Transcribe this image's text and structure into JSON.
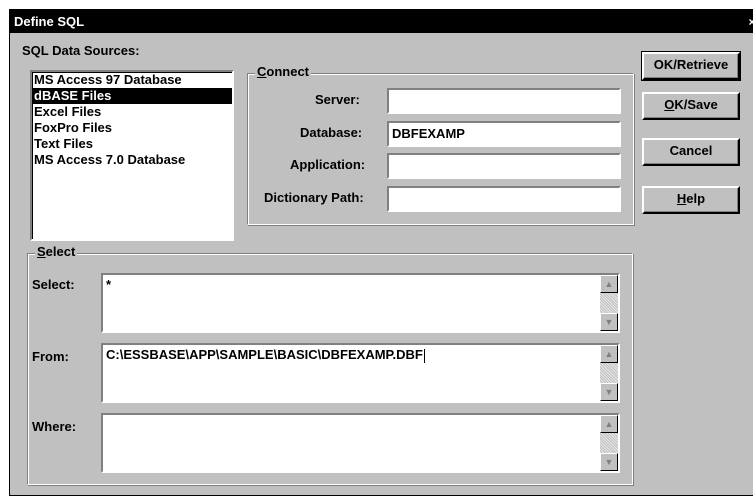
{
  "window": {
    "title": "Define SQL",
    "close_glyph": "×"
  },
  "data_sources": {
    "label": "SQL Data Sources:",
    "items": [
      "MS Access 97 Database",
      "dBASE Files",
      "Excel Files",
      "FoxPro Files",
      "Text Files",
      "MS Access 7.0 Database"
    ],
    "selected": "dBASE Files"
  },
  "connect": {
    "title_accel": "C",
    "title_rest": "onnect",
    "server_label": "Server:",
    "server_value": "",
    "database_label": "Database:",
    "database_value": "DBFEXAMP",
    "application_label": "Application:",
    "application_value": "",
    "dictionary_label": "Dictionary Path:",
    "dictionary_value": ""
  },
  "select_group": {
    "title_accel": "S",
    "title_rest": "elect",
    "select_label": "Select:",
    "select_value": "*",
    "from_label": "From:",
    "from_value": "C:\\ESSBASE\\APP\\SAMPLE\\BASIC\\DBFEXAMP.DBF",
    "where_label": "Where:",
    "where_value": ""
  },
  "buttons": {
    "ok_retrieve": "OK/Retrieve",
    "ok_save_accel": "O",
    "ok_save_rest": "K/Save",
    "cancel": "Cancel",
    "help_accel": "H",
    "help_rest": "elp"
  },
  "icons": {
    "scroll_up": "▲",
    "scroll_down": "▼"
  }
}
